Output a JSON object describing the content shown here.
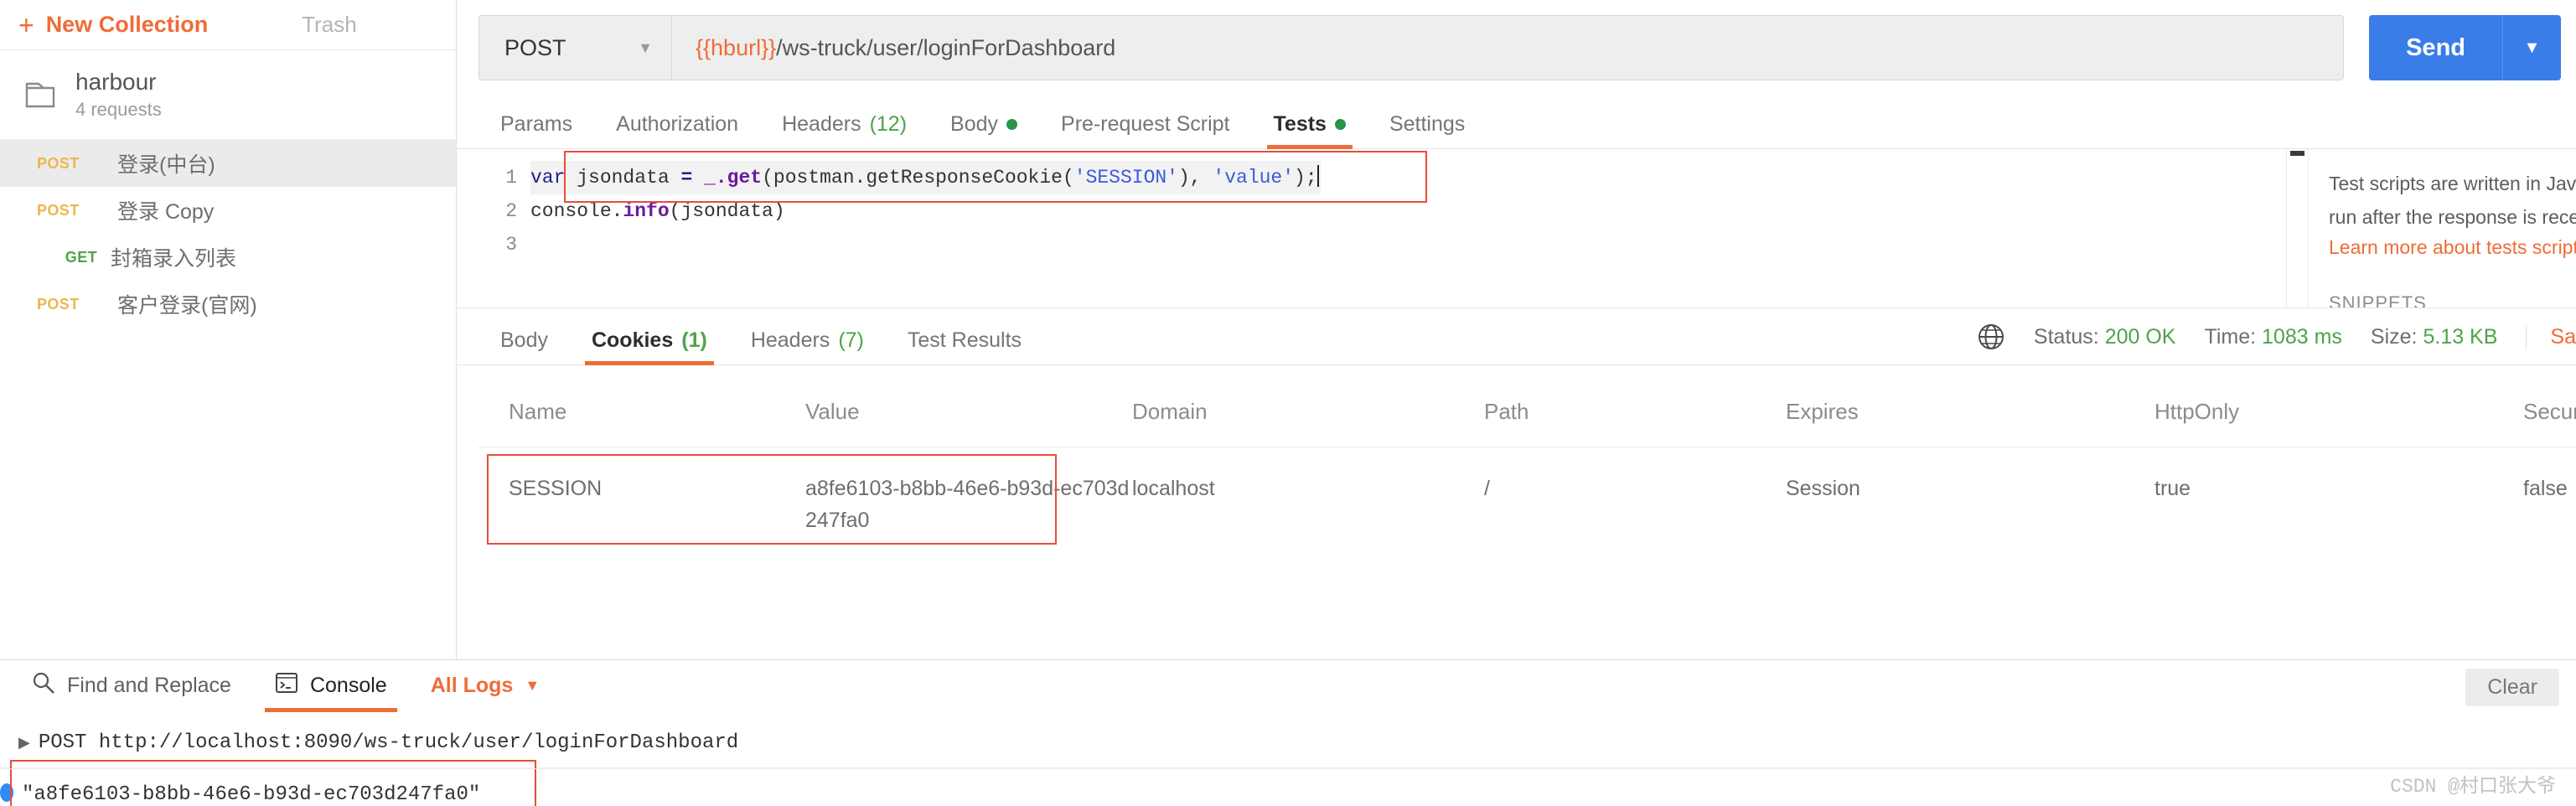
{
  "sidebar": {
    "new_collection_label": "New Collection",
    "plus_icon": "plus-icon",
    "trash_label": "Trash",
    "collection": {
      "icon": "folder-icon",
      "name": "harbour",
      "count": "4 requests"
    },
    "requests": [
      {
        "method": "POST",
        "name": "登录(中台)",
        "selected": true
      },
      {
        "method": "POST",
        "name": "登录 Copy",
        "selected": false
      },
      {
        "method": "GET",
        "name": "封箱录入列表",
        "selected": false
      },
      {
        "method": "POST",
        "name": "客户登录(官网)",
        "selected": false
      }
    ]
  },
  "request": {
    "method": "POST",
    "method_caret": "chevron-down-icon",
    "url_variable": "{{hburl}}",
    "url_path": "/ws-truck/user/loginForDashboard",
    "send_label": "Send",
    "send_caret": "chevron-down-icon",
    "tabs": [
      {
        "label": "Params",
        "count": "",
        "dot": false,
        "active": false
      },
      {
        "label": "Authorization",
        "count": "",
        "dot": false,
        "active": false
      },
      {
        "label": "Headers",
        "count": "(12)",
        "dot": false,
        "active": false
      },
      {
        "label": "Body",
        "count": "",
        "dot": true,
        "active": false
      },
      {
        "label": "Pre-request Script",
        "count": "",
        "dot": false,
        "active": false
      },
      {
        "label": "Tests",
        "count": "",
        "dot": true,
        "active": true
      },
      {
        "label": "Settings",
        "count": "",
        "dot": false,
        "active": false
      }
    ]
  },
  "editor": {
    "line_numbers": [
      "1",
      "2",
      "3"
    ],
    "line1": {
      "kw": "var",
      "name": " jsondata ",
      "op": "=",
      "call": " _.get",
      "args_open": "(postman.getResponseCookie(",
      "str1": "'SESSION'",
      "mid": "), ",
      "str2": "'value'",
      "close": ");"
    },
    "line2": {
      "obj": "console.",
      "fn": "info",
      "arg": "(jsondata)"
    }
  },
  "snippets": {
    "text_line1": "Test scripts are written in Java",
    "text_line2": "run after the response is rece",
    "link": "Learn more about tests script",
    "header": "SNIPPETS"
  },
  "response": {
    "tabs": [
      {
        "label": "Body",
        "count": "",
        "active": false
      },
      {
        "label": "Cookies",
        "count": "(1)",
        "active": true
      },
      {
        "label": "Headers",
        "count": "(7)",
        "active": false
      },
      {
        "label": "Test Results",
        "count": "",
        "active": false
      }
    ],
    "globe_icon": "globe-icon",
    "status_label": "Status:",
    "status_value": "200 OK",
    "time_label": "Time:",
    "time_value": "1083 ms",
    "size_label": "Size:",
    "size_value": "5.13 KB",
    "save_label": "Sa",
    "cookies": {
      "columns": [
        "Name",
        "Value",
        "Domain",
        "Path",
        "Expires",
        "HttpOnly",
        "Secure"
      ],
      "rows": [
        {
          "name": "SESSION",
          "value": "a8fe6103-b8bb-46e6-b93d-ec703d247fa0",
          "domain": "localhost",
          "path": "/",
          "expires": "Session",
          "httponly": "true",
          "secure": "false"
        }
      ]
    }
  },
  "console": {
    "find_replace_label": "Find and Replace",
    "find_icon": "search-icon",
    "console_label": "Console",
    "console_icon": "terminal-icon",
    "all_logs_label": "All Logs",
    "all_logs_caret": "chevron-down-icon",
    "clear_label": "Clear",
    "log_request": "POST http://localhost:8090/ws-truck/user/loginForDashboard",
    "log_value": "\"a8fe6103-b8bb-46e6-b93d-ec703d247fa0\""
  },
  "watermark": "CSDN @村口张大爷",
  "colors": {
    "accent": "#ef6c37",
    "send_blue": "#3a7ce8",
    "green": "#4ca449",
    "post_yellow": "#eeb64b",
    "highlight_red": "#e84c3d"
  }
}
